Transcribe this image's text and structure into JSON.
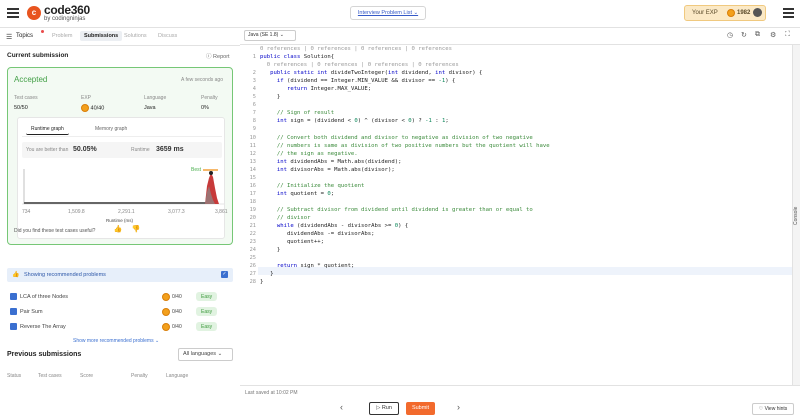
{
  "header": {
    "logo_mark": "c",
    "logo_text": "code360",
    "logo_sub": "by codingninjas",
    "problem_list_label": "Interview Problem List",
    "exp_label": "Your EXP",
    "exp_value": "1982"
  },
  "left_tabs": {
    "topics": "Topics",
    "problem": "Problem",
    "submissions": "Submissions",
    "solutions": "Solutions",
    "discuss": "Discuss"
  },
  "submission": {
    "heading": "Current submission",
    "report": "Report",
    "status": "Accepted",
    "time_ago": "A few seconds ago",
    "test_cases_label": "Test cases",
    "test_cases_value": "50/50",
    "exp_label": "EXP",
    "exp_value": "40/40",
    "language_label": "Language",
    "language_value": "Java",
    "penalty_label": "Penalty",
    "penalty_value": "0%",
    "runtime_tab": "Runtime graph",
    "memory_tab": "Memory graph",
    "better_than_label": "You are better than",
    "better_than_value": "50.05%",
    "runtime_label": "Runtime",
    "runtime_value": "3659 ms",
    "best_label": "Best",
    "x_ticks": [
      "734",
      "1,509.8",
      "2,291.1",
      "3,077.3",
      "3,861"
    ],
    "x_axis_label": "Runtime (ms)",
    "feedback_q": "Did you find these test cases useful?"
  },
  "recommended": {
    "heading": "Showing recommended problems",
    "items": [
      {
        "name": "LCA of three Nodes",
        "exp": "0/40",
        "difficulty": "Easy"
      },
      {
        "name": "Pair Sum",
        "exp": "0/40",
        "difficulty": "Easy"
      },
      {
        "name": "Reverse The Array",
        "exp": "0/40",
        "difficulty": "Easy"
      }
    ],
    "show_more": "Show more recommended problems"
  },
  "previous": {
    "heading": "Previous submissions",
    "filter": "All languages",
    "columns": [
      "Status",
      "Test cases",
      "Score",
      "Penalty",
      "Language"
    ]
  },
  "editor": {
    "language_select": "Java (SE 1.8)",
    "saved": "Last saved at 10:02 PM",
    "run": "Run",
    "submit": "Submit",
    "hints": "View hints",
    "console": "Console"
  },
  "code": {
    "line_numbers": [
      "",
      "1",
      "",
      "2",
      "3",
      "4",
      "5",
      "6",
      "7",
      "8",
      "9",
      "10",
      "11",
      "12",
      "13",
      "14",
      "15",
      "16",
      "17",
      "18",
      "19",
      "20",
      "21",
      "22",
      "23",
      "24",
      "25",
      "26",
      "27",
      "28"
    ]
  }
}
